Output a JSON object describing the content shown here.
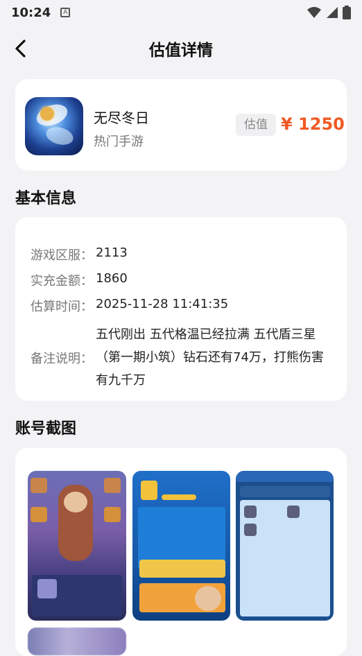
{
  "status_bar": {
    "time": "10:24",
    "notification_icon": "a-icon",
    "wifi_icon": "wifi-icon",
    "signal_icon": "signal-icon",
    "battery_icon": "battery-icon"
  },
  "nav": {
    "title": "估值详情",
    "back_icon": "chevron-left-icon"
  },
  "game": {
    "name": "无尽冬日",
    "category": "热门手游",
    "valuation_tag": "估值",
    "valuation_price": "¥ 1250"
  },
  "basic_info": {
    "section_title": "基本信息",
    "rows": [
      {
        "label": "游戏区服：",
        "value": "2113"
      },
      {
        "label": "实充金额：",
        "value": "1860"
      },
      {
        "label": "估算时间：",
        "value": "2025-11-28 11:41:35"
      },
      {
        "label": "备注说明：",
        "value": "五代刚出 五代格温已经拉满 五代盾三星（第一期小筑）钻石还有74万，打熊伤害有九千万"
      }
    ]
  },
  "screenshots": {
    "section_title": "账号截图",
    "items": [
      {
        "name": "screenshot-1"
      },
      {
        "name": "screenshot-2"
      },
      {
        "name": "screenshot-3"
      },
      {
        "name": "screenshot-4"
      }
    ]
  },
  "colors": {
    "accent": "#f05a24",
    "background": "#f3f3f5",
    "card": "#ffffff"
  }
}
